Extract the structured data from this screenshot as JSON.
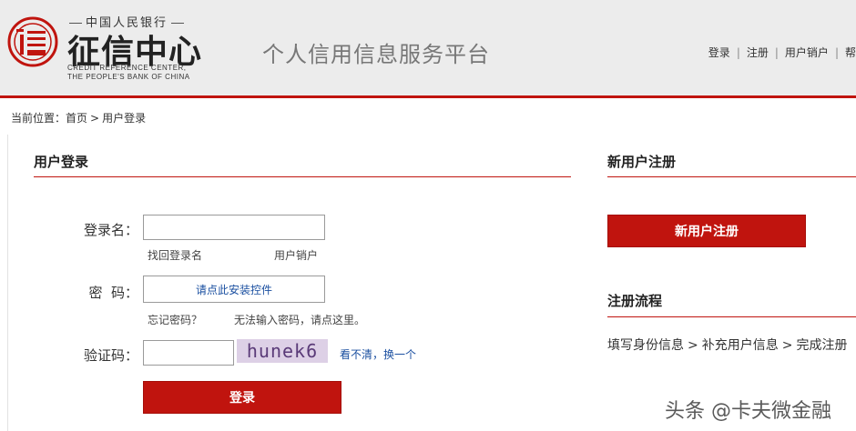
{
  "header": {
    "logo_top": "中国人民银行",
    "logo_main": "征信中心",
    "logo_en_line1": "CREDIT REFERENCE CENTER,",
    "logo_en_line2": "THE PEOPLE'S BANK OF CHINA",
    "platform_title": "个人信用信息服务平台",
    "links": [
      "登录",
      "注册",
      "用户销户",
      "帮"
    ],
    "brand_color": "#c0140e"
  },
  "breadcrumb": {
    "prefix": "当前位置：",
    "home": "首页",
    "separator": ">",
    "current": "用户登录"
  },
  "login": {
    "title": "用户登录",
    "username_label": "登录名：",
    "username_value": "",
    "find_login_name": "找回登录名",
    "user_cancel": "用户销户",
    "password_label": "密  码：",
    "install_control": "请点此安装控件",
    "forgot_password": "忘记密码？",
    "cannot_input": "无法输入密码，请点这里。",
    "captcha_label": "验证码：",
    "captcha_value": "",
    "captcha_image_text": "hunek6",
    "refresh_captcha": "看不清，换一个",
    "submit": "登录"
  },
  "register": {
    "title": "新用户注册",
    "button": "新用户注册",
    "flow_title": "注册流程",
    "flow_steps": [
      "填写身份信息",
      "补充用户信息",
      "完成注册"
    ],
    "flow_separator": ">"
  },
  "watermark": "头条 @卡夫微金融"
}
